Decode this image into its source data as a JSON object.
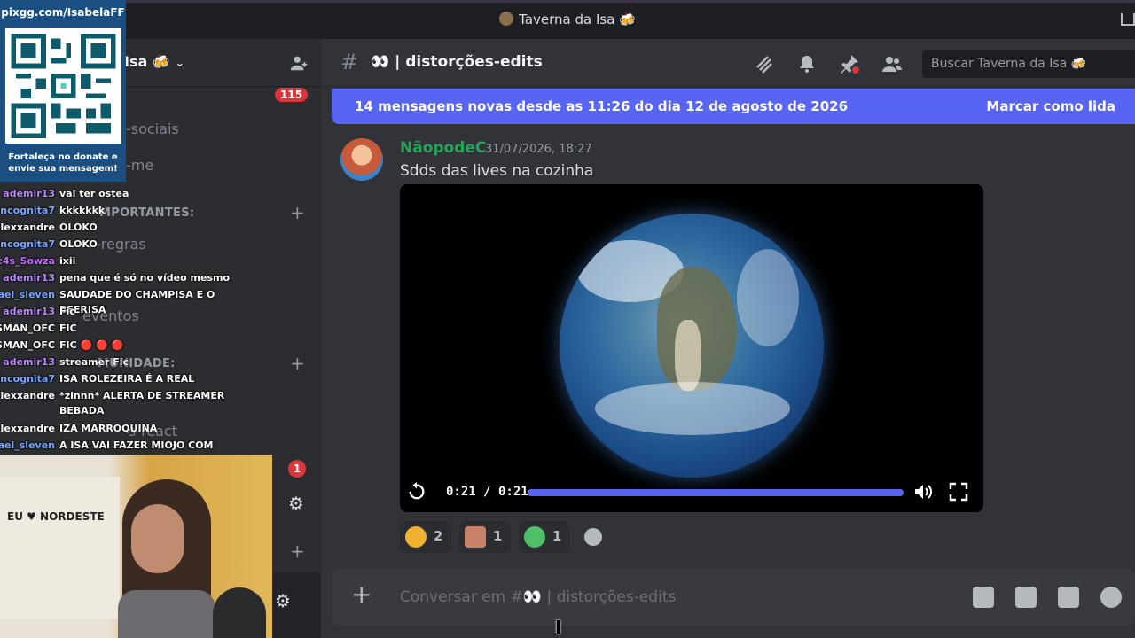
{
  "window": {
    "title": "Taverna da Isa 🍻"
  },
  "server": {
    "name": "Isa 🍻",
    "mention_count": "115",
    "unread_badge": "1",
    "channels": [
      {
        "label": "-sociais"
      },
      {
        "label": "-me"
      },
      {
        "label": "MPORTANTES:"
      },
      {
        "label": "-regras"
      },
      {
        "label": "eventos"
      },
      {
        "label": "MUNIDADE:"
      },
      {
        "label": "s-react"
      }
    ]
  },
  "stream": {
    "qr_title": "pixgg.com/IsabelaFF",
    "qr_caption": "Fortaleça no donate e envie sua mensagem!",
    "webcam_sign": "EU ♥ NORDESTE",
    "chat": [
      {
        "user": "ademir13",
        "color": "#b988f5",
        "text": "vai ter ostea"
      },
      {
        "user": "Incognita7",
        "color": "#7aa7ff",
        "text": "kkkkkkk"
      },
      {
        "user": "_Alexxandre",
        "color": "#ffffff",
        "text": "OLOKO"
      },
      {
        "user": "Incognita7",
        "color": "#7aa7ff",
        "text": "OLOKO"
      },
      {
        "user": "c4s_Sowza",
        "color": "#c46bff",
        "text": "ixii"
      },
      {
        "user": "ademir13",
        "color": "#b988f5",
        "text": "pena que é só no vídeo mesmo"
      },
      {
        "user": "afael_sleven",
        "color": "#7aa7ff",
        "text": "SAUDADE DO CHAMPISA E O BEERISA"
      },
      {
        "user": "ademir13",
        "color": "#b988f5",
        "text": "Fic"
      },
      {
        "user": "SMAN_OFC",
        "color": "#ffffff",
        "text": "FIC"
      },
      {
        "user": "SMAN_OFC",
        "color": "#ffffff",
        "text": "FIC 🔴 🔴 🔴"
      },
      {
        "user": "ademir13",
        "color": "#b988f5",
        "text": "streamer Fic"
      },
      {
        "user": "Incognita7",
        "color": "#7aa7ff",
        "text": "ISA ROLEZEIRA É A REAL"
      },
      {
        "user": "_Alexxandre",
        "color": "#ffffff",
        "text": "*zinnn* ALERTA DE STREAMER BEBADA"
      },
      {
        "user": "_Alexxandre",
        "color": "#ffffff",
        "text": "IZA MARROQUINA"
      },
      {
        "user": "afael_sleven",
        "color": "#7aa7ff",
        "text": "A ISA VAI FAZER MIOJO COM LEITE?"
      }
    ]
  },
  "channel": {
    "hash": "#",
    "name": "👀 | distorções-edits",
    "search_placeholder": "Buscar Taverna da Isa 🍻"
  },
  "new_messages": {
    "text": "14 mensagens novas desde as 11:26 do dia 12 de agosto de 2026",
    "mark_read": "Marcar como lida"
  },
  "message": {
    "author": "NãopodeC",
    "timestamp": "31/07/2026, 18:27",
    "text": "Sdds das lives na cozinha",
    "video": {
      "time": "0:21 / 0:21",
      "progress": 1.0
    },
    "reactions": [
      {
        "emoji": "joy-emoji",
        "color": "#f0b232",
        "count": "2"
      },
      {
        "emoji": "custom-face-emoji",
        "color": "#c9826a",
        "count": "1"
      },
      {
        "emoji": "custom-pixel-emoji",
        "color": "#4fbf6a",
        "count": "1"
      }
    ]
  },
  "composer": {
    "placeholder": "Conversar em #👀 | distorções-edits"
  },
  "colors": {
    "accent": "#5865f2",
    "author": "#23a55a",
    "danger": "#da373c"
  }
}
